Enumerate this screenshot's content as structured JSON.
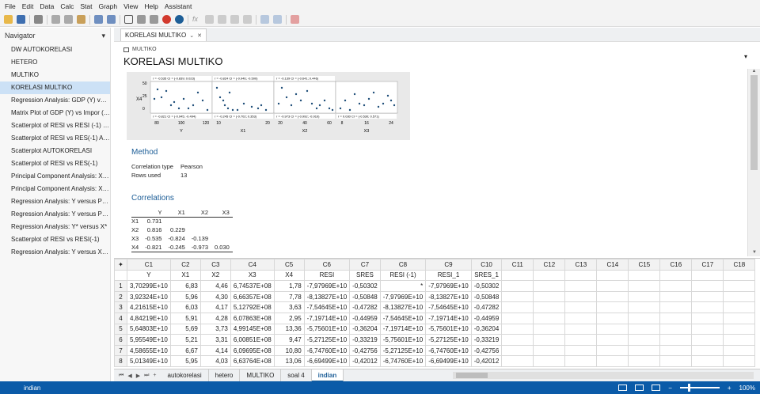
{
  "menu": [
    "File",
    "Edit",
    "Data",
    "Calc",
    "Stat",
    "Graph",
    "View",
    "Help",
    "Assistant"
  ],
  "navigator": {
    "title": "Navigator",
    "items": [
      "DW AUTOKORELASI",
      "HETERO",
      "MULTIKO",
      "KORELASI MULTIKO",
      "Regression Analysis: GDP (Y) versu...",
      "Matrix Plot of GDP (Y) vs Impor (X...",
      "Scatterplot of RESI vs RESI (-1) SO...",
      "Scatterplot of RESI vs RES(-1) AUT...",
      "Scatterplot AUTOKORELASI",
      "Scatterplot of RESI vs RES(-1)",
      "Principal Component Analysis: X1, ...",
      "Principal Component Analysis: X1, ...",
      "Regression Analysis: Y versus PC1, ...",
      "Regression Analysis: Y versus PC1",
      "Regression Analysis: Y* versus X*",
      "Scatterplot of RESI vs RESI(-1)",
      "Regression Analysis: Y versus X1; X..."
    ],
    "active_index": 3
  },
  "output": {
    "tab_label": "KORELASI MULTIKO",
    "small_label": "MULTIKO",
    "title": "KORELASI MULTIKO",
    "graph": {
      "x_axis_labels": [
        "Y",
        "X1",
        "X2",
        "X3"
      ],
      "row_label": "X4",
      "y_ticks": [
        "50",
        "25",
        "0"
      ],
      "x_ticks": [
        [
          "80",
          "100",
          "120"
        ],
        [
          "10",
          "20"
        ],
        [
          "20",
          "40",
          "60"
        ],
        [
          "8",
          "16",
          "24"
        ]
      ],
      "top_annotations": [
        "r = -0.535  CI = (-0.839; 0.023)",
        "r = -0.824  CI = (-0.946; -0.500)",
        "r = -0.139  CI = (-0.641; 0.446)",
        ""
      ],
      "bottom_annotations": [
        "r = -0.821  CI = (-0.945; -0.494)",
        "r = -0.245  CI = (-0.702; 0.353)",
        "r = -0.973  CI = (-0.992; -0.910)",
        "r = 0.030  CI = (-0.530; 0.571)"
      ]
    },
    "method": {
      "heading": "Method",
      "rows": [
        {
          "key": "Correlation type",
          "value": "Pearson"
        },
        {
          "key": "Rows used",
          "value": "13"
        }
      ]
    },
    "correlations": {
      "heading": "Correlations",
      "columns": [
        "",
        "Y",
        "X1",
        "X2",
        "X3"
      ],
      "rows": [
        [
          "X1",
          "0.731",
          "",
          "",
          ""
        ],
        [
          "X2",
          "0.816",
          "0.229",
          "",
          ""
        ],
        [
          "X3",
          "-0.535",
          "-0.824",
          "-0.139",
          ""
        ],
        [
          "X4",
          "-0.821",
          "-0.245",
          "-0.973",
          "0.030"
        ]
      ]
    }
  },
  "worksheet": {
    "column_ids": [
      "C1",
      "C2",
      "C3",
      "C4",
      "C5",
      "C6",
      "C7",
      "C8",
      "C9",
      "C10",
      "C11",
      "C12",
      "C13",
      "C14",
      "C15",
      "C16",
      "C17",
      "C18"
    ],
    "column_names": [
      "Y",
      "X1",
      "X2",
      "X3",
      "X4",
      "RESI",
      "SRES",
      "RESI (-1)",
      "RESI_1",
      "SRES_1",
      "",
      "",
      "",
      "",
      "",
      "",
      "",
      ""
    ],
    "rows": [
      [
        "3,70299E+10",
        "6,83",
        "4,46",
        "6,74537E+08",
        "1,78",
        "-7,97969E+10",
        "-0,50302",
        "*",
        "-7,97969E+10",
        "-0,50302"
      ],
      [
        "3,92324E+10",
        "5,96",
        "4,30",
        "6,66357E+08",
        "7,78",
        "-8,13827E+10",
        "-0,50848",
        "-7,97969E+10",
        "-8,13827E+10",
        "-0,50848"
      ],
      [
        "4,21615E+10",
        "6,03",
        "4,17",
        "5,12792E+08",
        "3,63",
        "-7,54645E+10",
        "-0,47282",
        "-8,13827E+10",
        "-7,54645E+10",
        "-0,47282"
      ],
      [
        "4,84219E+10",
        "5,91",
        "4,28",
        "6,07863E+08",
        "2,95",
        "-7,19714E+10",
        "-0,44959",
        "-7,54645E+10",
        "-7,19714E+10",
        "-0,44959"
      ],
      [
        "5,64803E+10",
        "5,69",
        "3,73",
        "4,99145E+08",
        "13,36",
        "-5,75601E+10",
        "-0,36204",
        "-7,19714E+10",
        "-5,75601E+10",
        "-0,36204"
      ],
      [
        "5,95549E+10",
        "5,21",
        "3,31",
        "6,00851E+08",
        "9,47",
        "-5,27125E+10",
        "-0,33219",
        "-5,75601E+10",
        "-5,27125E+10",
        "-0,33219"
      ],
      [
        "4,58655E+10",
        "6,67",
        "4,14",
        "6,09695E+08",
        "10,80",
        "-6,74760E+10",
        "-0,42756",
        "-5,27125E+10",
        "-6,74760E+10",
        "-0,42756"
      ],
      [
        "5,01349E+10",
        "5,95",
        "4,03",
        "6,63764E+08",
        "13,06",
        "-6,69499E+10",
        "-0,42012",
        "-6,74760E+10",
        "-6,69499E+10",
        "-0,42012"
      ]
    ],
    "sheet_tabs": [
      "autokorelasi",
      "hetero",
      "MULTIKO",
      "soal 4",
      "indian"
    ],
    "active_sheet_index": 4
  },
  "status": {
    "sheet_name": "indian",
    "zoom": "100%"
  },
  "colors": {
    "accent": "#1d5e97",
    "statusbar": "#0b5ba8",
    "nav_active": "#cce1f6",
    "plot_point": "#1f4e79"
  }
}
